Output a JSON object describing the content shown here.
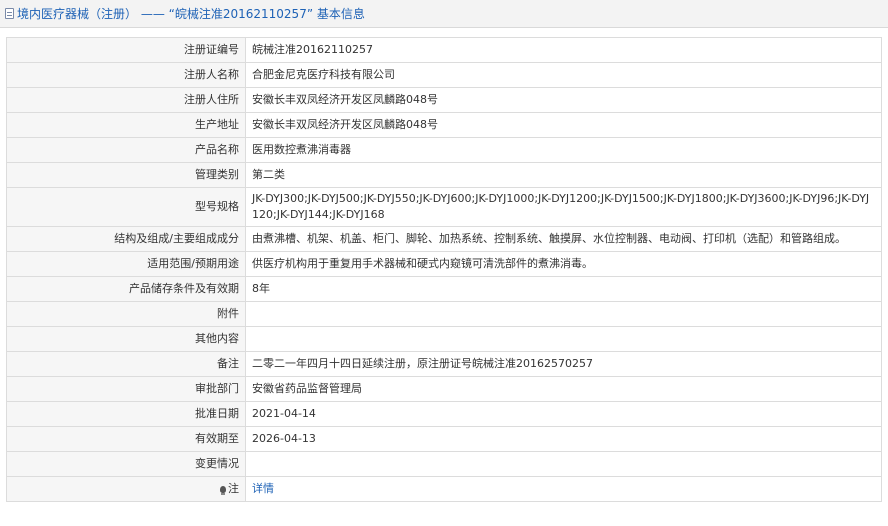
{
  "header": {
    "icon": "document-icon",
    "title": "境内医疗器械（注册） ——  “皖械注准20162110257” 基本信息"
  },
  "rows": [
    {
      "label": "注册证编号",
      "value": "皖械注准20162110257"
    },
    {
      "label": "注册人名称",
      "value": "合肥金尼克医疗科技有限公司"
    },
    {
      "label": "注册人住所",
      "value": "安徽长丰双凤经济开发区凤麟路048号"
    },
    {
      "label": "生产地址",
      "value": "安徽长丰双凤经济开发区凤麟路048号"
    },
    {
      "label": "产品名称",
      "value": "医用数控煮沸消毒器"
    },
    {
      "label": "管理类别",
      "value": "第二类"
    },
    {
      "label": "型号规格",
      "value": "JK-DYJ300;JK-DYJ500;JK-DYJ550;JK-DYJ600;JK-DYJ1000;JK-DYJ1200;JK-DYJ1500;JK-DYJ1800;JK-DYJ3600;JK-DYJ96;JK-DYJ120;JK-DYJ144;JK-DYJ168"
    },
    {
      "label": "结构及组成/主要组成成分",
      "value": "由煮沸槽、机架、机盖、柜门、脚轮、加热系统、控制系统、触摸屏、水位控制器、电动阀、打印机（选配）和管路组成。"
    },
    {
      "label": "适用范围/预期用途",
      "value": "供医疗机构用于重复用手术器械和硬式内窥镜可清洗部件的煮沸消毒。"
    },
    {
      "label": "产品储存条件及有效期",
      "value": "8年"
    },
    {
      "label": "附件",
      "value": ""
    },
    {
      "label": "其他内容",
      "value": ""
    },
    {
      "label": "备注",
      "value": "二零二一年四月十四日延续注册，原注册证号皖械注准20162570257"
    },
    {
      "label": "审批部门",
      "value": "安徽省药品监督管理局"
    },
    {
      "label": "批准日期",
      "value": "2021-04-14"
    },
    {
      "label": "有效期至",
      "value": "2026-04-13"
    },
    {
      "label": "变更情况",
      "value": ""
    }
  ],
  "note_row": {
    "icon": "lightbulb-icon",
    "label": "注",
    "link_text": "详情"
  },
  "colors": {
    "link": "#1e62b6",
    "label_bg": "#f6f6f6",
    "border": "#dcdcdc"
  }
}
